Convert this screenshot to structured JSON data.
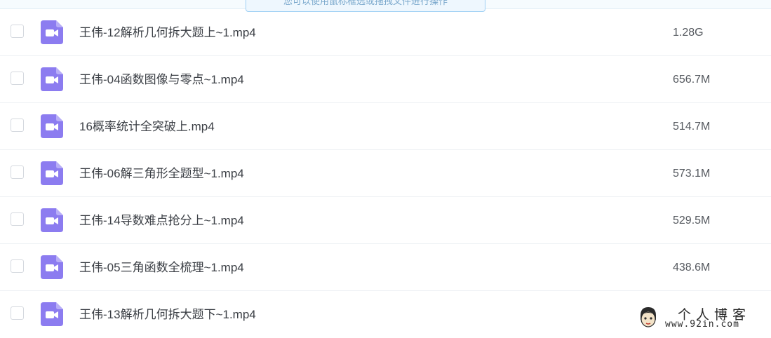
{
  "tooltip": {
    "text": "您可以使用鼠标框选或拖拽文件进行操作"
  },
  "colors": {
    "video_icon": "#8c7cf0",
    "video_icon_fold": "#b8aef7",
    "row_divider": "#eef1f4",
    "tooltip_border": "#9fd0f4"
  },
  "files": [
    {
      "name": "王伟-12解析几何拆大题上~1.mp4",
      "size": "1.28G",
      "icon": "video-file-icon"
    },
    {
      "name": "王伟-04函数图像与零点~1.mp4",
      "size": "656.7M",
      "icon": "video-file-icon"
    },
    {
      "name": "16概率统计全突破上.mp4",
      "size": "514.7M",
      "icon": "video-file-icon"
    },
    {
      "name": "王伟-06解三角形全题型~1.mp4",
      "size": "573.1M",
      "icon": "video-file-icon"
    },
    {
      "name": "王伟-14导数难点抢分上~1.mp4",
      "size": "529.5M",
      "icon": "video-file-icon"
    },
    {
      "name": "王伟-05三角函数全梳理~1.mp4",
      "size": "438.6M",
      "icon": "video-file-icon"
    },
    {
      "name": "王伟-13解析几何拆大题下~1.mp4",
      "size": "",
      "icon": "video-file-icon"
    }
  ],
  "watermark": {
    "title": "个人博客",
    "url": "www.92in.com"
  }
}
